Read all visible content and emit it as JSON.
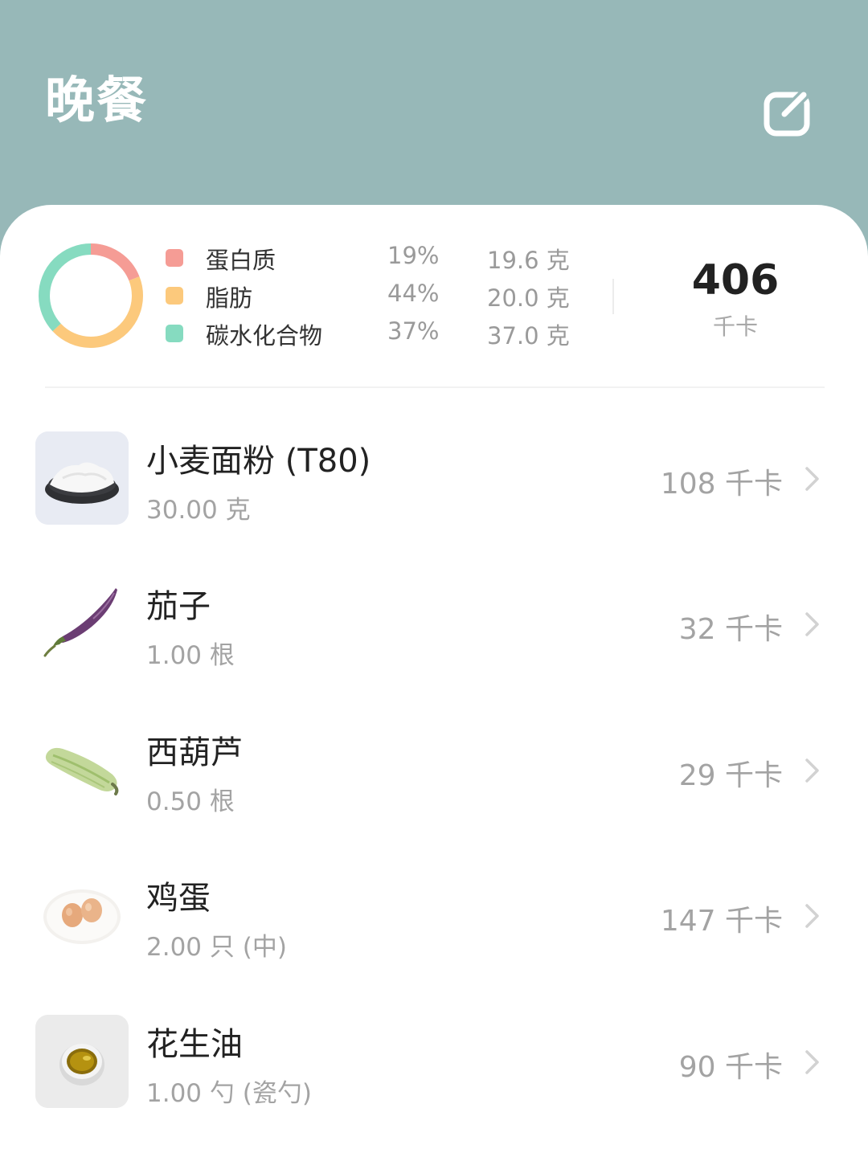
{
  "header": {
    "title": "晚餐",
    "edit_icon": "edit-icon"
  },
  "summary": {
    "donut_colors": {
      "protein": "#f59c95",
      "fat": "#fcc97c",
      "carbs": "#86dbc0"
    },
    "macros": [
      {
        "name": "蛋白质",
        "percent": "19%",
        "grams": "19.6 克",
        "color": "#f59c95",
        "share": 0.19
      },
      {
        "name": "脂肪",
        "percent": "44%",
        "grams": "20.0 克",
        "color": "#fcc97c",
        "share": 0.44
      },
      {
        "name": "碳水化合物",
        "percent": "37%",
        "grams": "37.0 克",
        "color": "#86dbc0",
        "share": 0.37
      }
    ],
    "total_kcal": "406",
    "total_unit": "千卡"
  },
  "foods": [
    {
      "name": "小麦面粉 (T80)",
      "amount": "30.00 克",
      "kcal": "108 千卡",
      "icon": "flour-icon"
    },
    {
      "name": "茄子",
      "amount": "1.00 根",
      "kcal": "32 千卡",
      "icon": "eggplant-icon"
    },
    {
      "name": "西葫芦",
      "amount": "0.50 根",
      "kcal": "29 千卡",
      "icon": "zucchini-icon"
    },
    {
      "name": "鸡蛋",
      "amount": "2.00 只 (中)",
      "kcal": "147 千卡",
      "icon": "egg-icon"
    },
    {
      "name": "花生油",
      "amount": "1.00 勺 (瓷勺)",
      "kcal": "90 千卡",
      "icon": "oil-icon"
    }
  ]
}
